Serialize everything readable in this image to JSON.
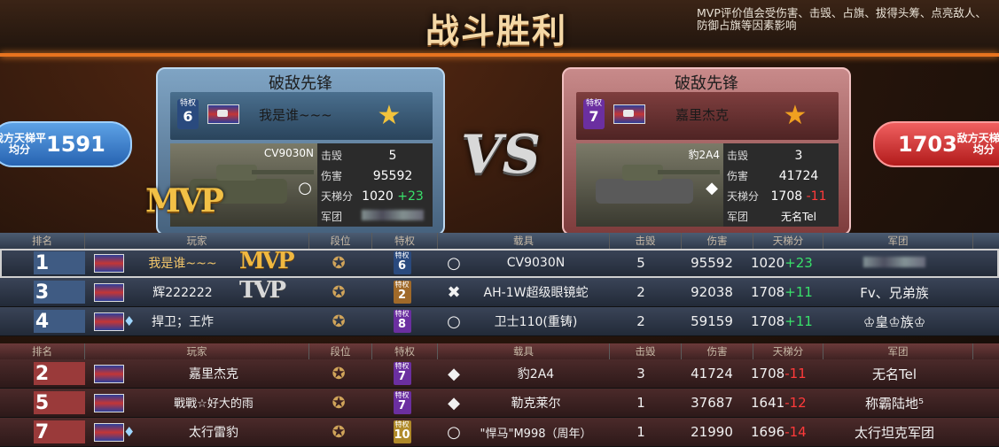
{
  "title": "战斗胜利",
  "mvp_note": "MVP评价值会受伤害、击毁、占旗、拔得头筹、点亮敌人、防御占旗等因素影响",
  "ally_avg": {
    "label": "我方天梯平均分",
    "value": "1591"
  },
  "enemy_avg": {
    "label": "敌方天梯平均分",
    "value": "1703"
  },
  "vs_label": "VS",
  "mvp_label": "MVP",
  "left_card": {
    "title": "破敌先锋",
    "rank_label": "特权",
    "rank_num": "6",
    "name": "我是谁~~~",
    "tank": "CV9030N",
    "class_icon": "○",
    "kills_label": "击毁",
    "kills": "5",
    "damage_label": "伤害",
    "damage": "95592",
    "ladder_label": "天梯分",
    "ladder": "1020",
    "ladder_delta": "+23",
    "guild_label": "军团"
  },
  "right_card": {
    "title": "破敌先锋",
    "rank_label": "特权",
    "rank_num": "7",
    "name": "嘉里杰克",
    "tank": "豹2A4",
    "class_icon": "◆",
    "kills_label": "击毁",
    "kills": "3",
    "damage_label": "伤害",
    "damage": "41724",
    "ladder_label": "天梯分",
    "ladder": "1708",
    "ladder_delta": "-11",
    "guild_label": "军团",
    "guild": "无名Tel"
  },
  "headers": [
    "排名",
    "玩家",
    "段位",
    "特权",
    "载具",
    "击毁",
    "伤害",
    "天梯分",
    "军团"
  ],
  "ally_rows": [
    {
      "rank": "1",
      "name": "我是谁~~~",
      "badge": "MVP",
      "tq": "6",
      "icon": "○",
      "vehicle": "CV9030N",
      "kills": "5",
      "damage": "95592",
      "ladder": "1020",
      "delta": "+23",
      "guild": ""
    },
    {
      "rank": "3",
      "name": "辉222222",
      "badge": "TVP",
      "tq": "2",
      "icon": "✖",
      "vehicle": "AH-1W超级眼镜蛇",
      "kills": "2",
      "damage": "92038",
      "ladder": "1708",
      "delta": "+11",
      "guild": "Fv、兄弟族"
    },
    {
      "rank": "4",
      "name": "捍卫；王炸",
      "badge": "",
      "tq": "8",
      "icon": "○",
      "vehicle": "卫士110(重铸)",
      "kills": "2",
      "damage": "59159",
      "ladder": "1708",
      "delta": "+11",
      "guild": "♔皇♔族♔"
    }
  ],
  "enemy_rows": [
    {
      "rank": "2",
      "name": "嘉里杰克",
      "tq": "7",
      "icon": "◆",
      "vehicle": "豹2A4",
      "kills": "3",
      "damage": "41724",
      "ladder": "1708",
      "delta": "-11",
      "guild": "无名Tel"
    },
    {
      "rank": "5",
      "name": "戰戰☆好大的雨",
      "tq": "7",
      "icon": "◆",
      "vehicle": "勒克莱尔",
      "kills": "1",
      "damage": "37687",
      "ladder": "1641",
      "delta": "-12",
      "guild": "称霸陆地⁵"
    },
    {
      "rank": "7",
      "name": "太行雷豹",
      "tq": "10",
      "icon": "○",
      "vehicle": "\"悍马\"M998（周年）",
      "kills": "1",
      "damage": "21990",
      "ladder": "1696",
      "delta": "-14",
      "guild": "太行坦克军团"
    }
  ],
  "tq_label": "特权",
  "colors": {
    "accent": "#e7731f",
    "plus": "#39e06a",
    "minus": "#ff3a3a",
    "ally": "#3f5b83",
    "enemy": "#9a3a3a"
  }
}
